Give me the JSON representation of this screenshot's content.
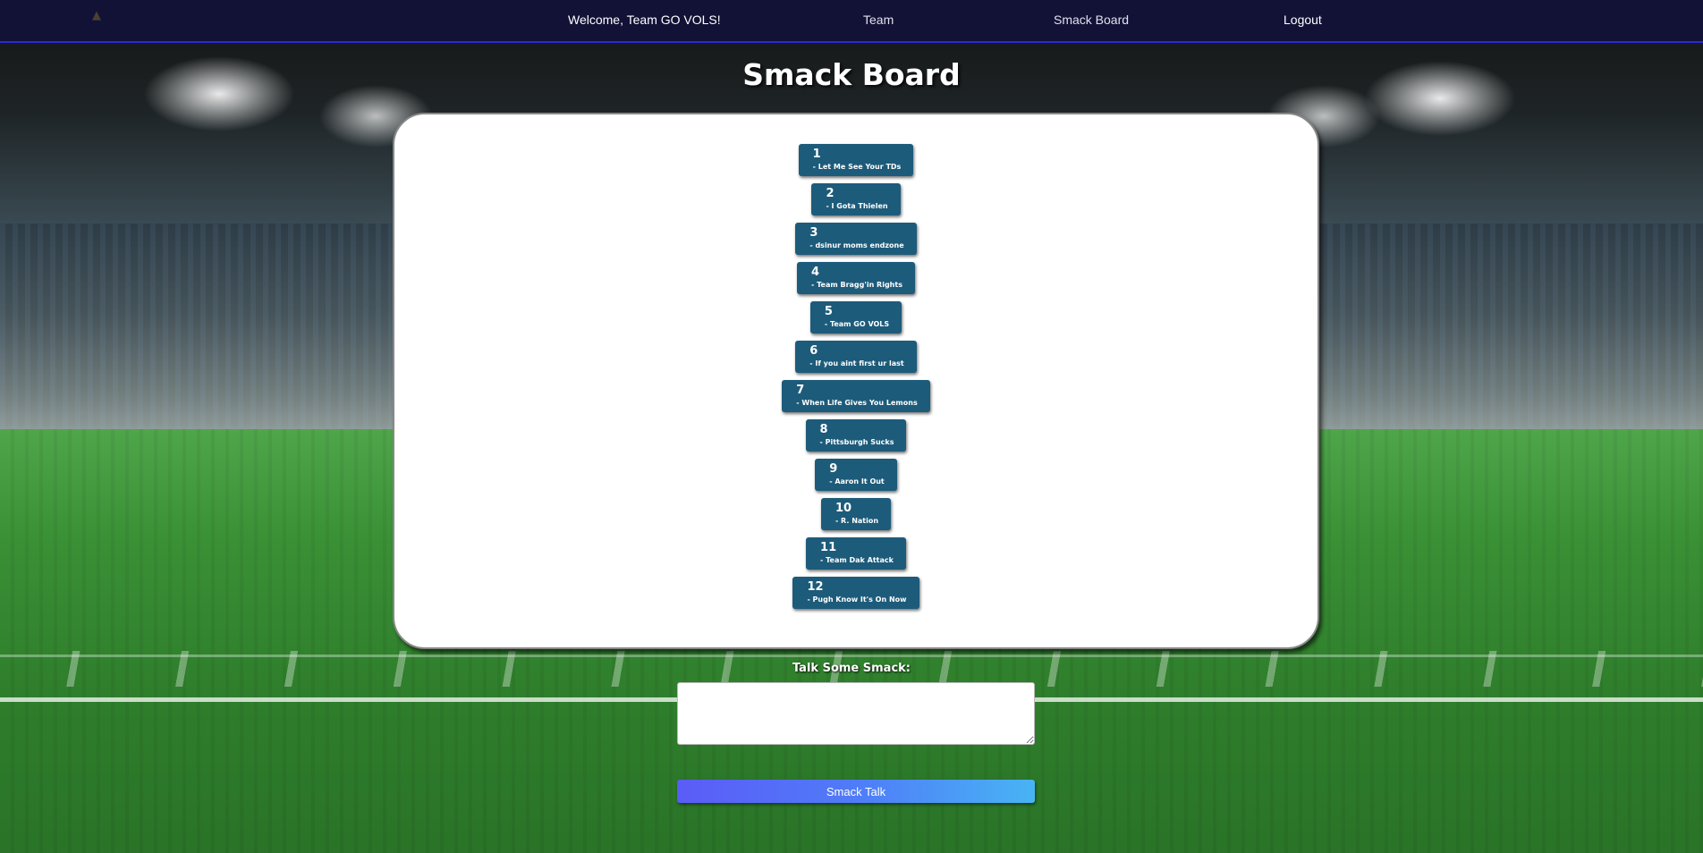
{
  "navbar": {
    "logo_icon": "mascot-logo-icon",
    "welcome": "Welcome, Team GO VOLS!",
    "team": "Team",
    "smack_board": "Smack Board",
    "logout": "Logout"
  },
  "page": {
    "title": "Smack Board"
  },
  "posts": [
    {
      "num": "1",
      "msg": "- Let Me See Your TDs"
    },
    {
      "num": "2",
      "msg": "- I Gota Thielen"
    },
    {
      "num": "3",
      "msg": "- dsinur moms endzone"
    },
    {
      "num": "4",
      "msg": "- Team Bragg'in Rights"
    },
    {
      "num": "5",
      "msg": "- Team GO VOLS"
    },
    {
      "num": "6",
      "msg": "- If you aint first ur last"
    },
    {
      "num": "7",
      "msg": "- When Life Gives You Lemons"
    },
    {
      "num": "8",
      "msg": "- Pittsburgh Sucks"
    },
    {
      "num": "9",
      "msg": "- Aaron It Out"
    },
    {
      "num": "10",
      "msg": "- R. Nation"
    },
    {
      "num": "11",
      "msg": "- Team Dak Attack"
    },
    {
      "num": "12",
      "msg": "- Pugh Know It's On Now"
    }
  ],
  "form": {
    "label": "Talk Some Smack:",
    "value": "",
    "button": "Smack Talk"
  },
  "colors": {
    "navbar": "#12123a",
    "post_bg": "#1d5b7a",
    "button_start": "#5b5cf7",
    "button_end": "#48b4f4"
  }
}
